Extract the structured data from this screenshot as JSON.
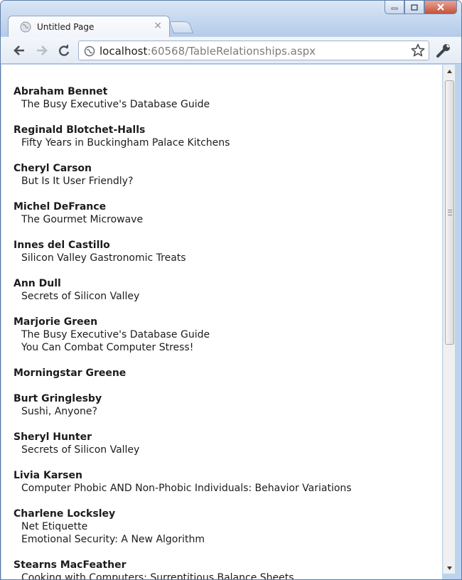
{
  "window": {
    "tab_title": "Untitled Page",
    "tab_close_glyph": "×"
  },
  "toolbar": {
    "url_host": "localhost",
    "url_rest": ":60568/TableRelationships.aspx"
  },
  "authors": [
    {
      "name": "Abraham Bennet",
      "books": [
        "The Busy Executive's Database Guide"
      ]
    },
    {
      "name": "Reginald Blotchet-Halls",
      "books": [
        "Fifty Years in Buckingham Palace Kitchens"
      ]
    },
    {
      "name": "Cheryl Carson",
      "books": [
        "But Is It User Friendly?"
      ]
    },
    {
      "name": "Michel DeFrance",
      "books": [
        "The Gourmet Microwave"
      ]
    },
    {
      "name": "Innes del Castillo",
      "books": [
        "Silicon Valley Gastronomic Treats"
      ]
    },
    {
      "name": "Ann Dull",
      "books": [
        "Secrets of Silicon Valley"
      ]
    },
    {
      "name": "Marjorie Green",
      "books": [
        "The Busy Executive's Database Guide",
        "You Can Combat Computer Stress!"
      ]
    },
    {
      "name": "Morningstar Greene",
      "books": []
    },
    {
      "name": "Burt Gringlesby",
      "books": [
        "Sushi, Anyone?"
      ]
    },
    {
      "name": "Sheryl Hunter",
      "books": [
        "Secrets of Silicon Valley"
      ]
    },
    {
      "name": "Livia Karsen",
      "books": [
        "Computer Phobic AND Non-Phobic Individuals: Behavior Variations"
      ]
    },
    {
      "name": "Charlene Locksley",
      "books": [
        "Net Etiquette",
        "Emotional Security: A New Algorithm"
      ]
    },
    {
      "name": "Stearns MacFeather",
      "books": [
        "Cooking with Computers: Surreptitious Balance Sheets"
      ]
    }
  ]
}
